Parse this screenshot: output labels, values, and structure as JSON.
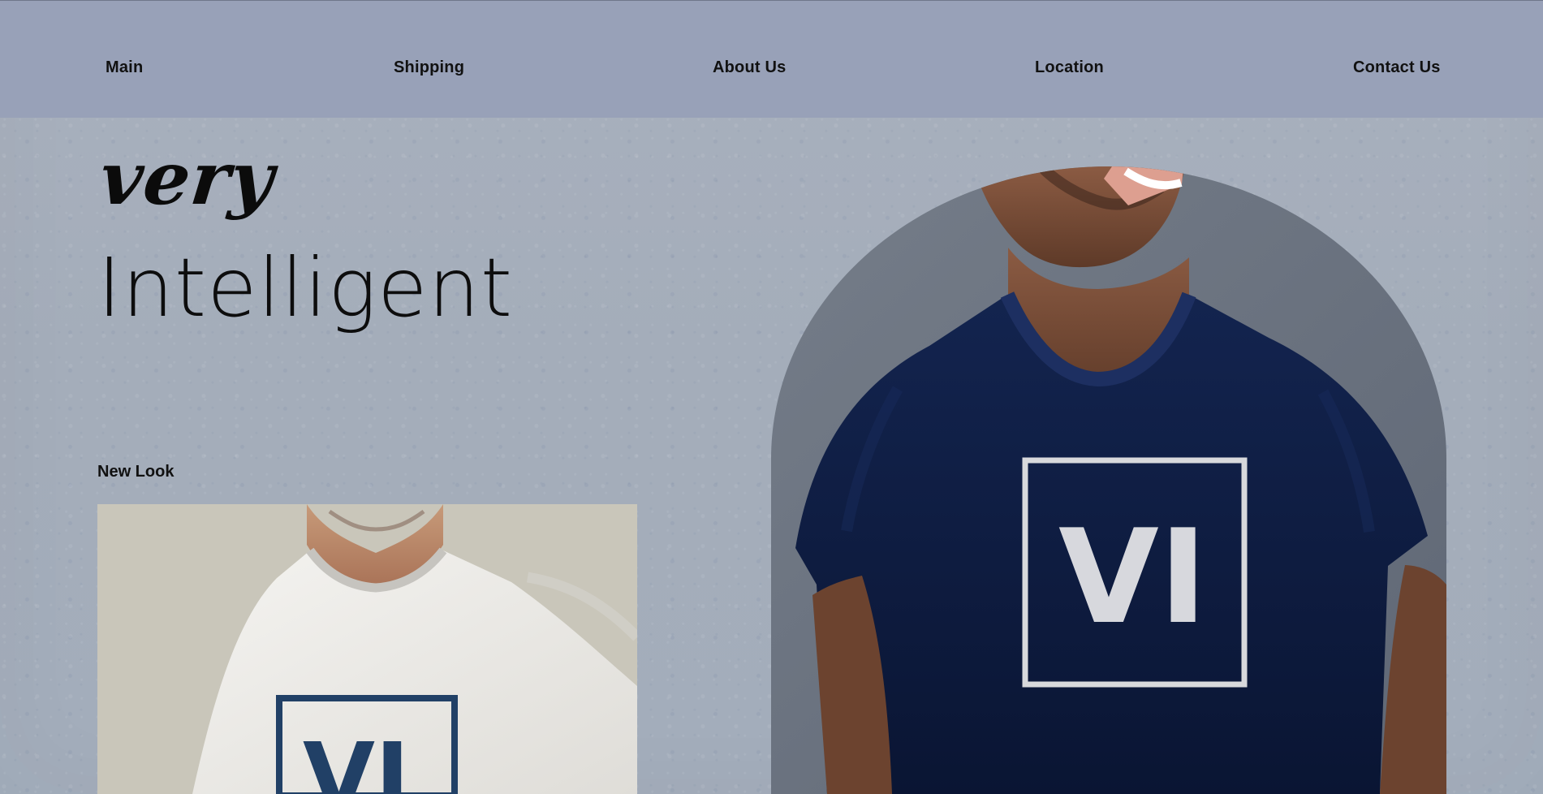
{
  "nav": {
    "items": [
      {
        "label": "Main"
      },
      {
        "label": "Shipping"
      },
      {
        "label": "About Us"
      },
      {
        "label": "Location"
      },
      {
        "label": "Contact Us"
      }
    ]
  },
  "hero": {
    "title_script": "very",
    "title_main": "Intelligent",
    "tag": "New Look"
  },
  "products": {
    "front_logo": "VI",
    "side_logo": "VI"
  },
  "colors": {
    "navy": "#0f1d44",
    "shirt_white": "#eceae6",
    "logo_blue": "#214066",
    "page_background": "#a7b0be",
    "nav_background": "#98a1b8"
  },
  "icons": {
    "brand_mark": "vi-logo-icon"
  }
}
